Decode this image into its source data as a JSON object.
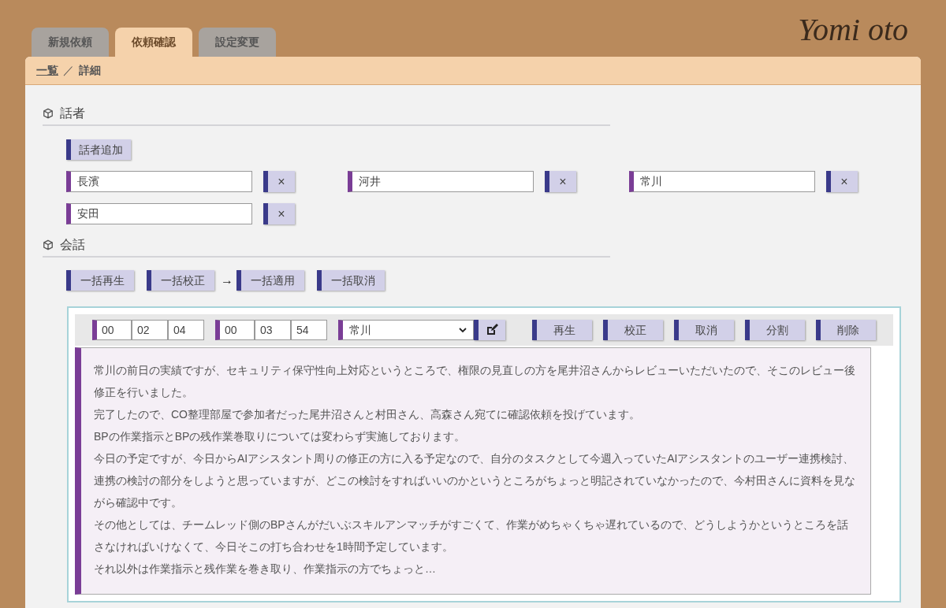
{
  "logo": "Yomi oto",
  "tabs": [
    {
      "label": "新規依頼",
      "selected": false
    },
    {
      "label": "依頼確認",
      "selected": true
    },
    {
      "label": "設定変更",
      "selected": false
    }
  ],
  "breadcrumb": {
    "link": "一覧",
    "separator": "／",
    "current": "詳細"
  },
  "speakers_section": {
    "title": "話者",
    "add_button": "話者追加",
    "remove_label": "×",
    "speakers": [
      "長濱",
      "河井",
      "常川",
      "安田"
    ]
  },
  "conversation_section": {
    "title": "会話",
    "bulk_actions": [
      {
        "kind": "button",
        "label": "一括再生"
      },
      {
        "kind": "button",
        "label": "一括校正"
      },
      {
        "kind": "arrow",
        "label": "→"
      },
      {
        "kind": "button",
        "label": "一括適用"
      },
      {
        "kind": "button",
        "label": "一括取消"
      }
    ],
    "segment": {
      "start": [
        "00",
        "02",
        "04"
      ],
      "end": [
        "00",
        "03",
        "54"
      ],
      "speaker": "常川",
      "actions": [
        "再生",
        "校正",
        "取消",
        "分割",
        "削除"
      ],
      "lines": [
        "常川の前日の実績ですが、セキュリティ保守性向上対応というところで、権限の見直しの方を尾井沼さんからレビューいただいたので、そこのレビュー後修正を行いました。",
        "完了したので、CO整理部屋で参加者だった尾井沼さんと村田さん、高森さん宛てに確認依頼を投げています。",
        "BPの作業指示とBPの残作業巻取りについては変わらず実施しております。",
        "今日の予定ですが、今日からAIアシスタント周りの修正の方に入る予定なので、自分のタスクとして今週入っていたAIアシスタントのユーザー連携検討、連携の検討の部分をしようと思っていますが、どこの検討をすればいいのかというところがちょっと明記されていなかったので、今村田さんに資料を見ながら確認中です。",
        "その他としては、チームレッド側のBPさんがだいぶスキルアンマッチがすごくて、作業がめちゃくちゃ遅れているので、どうしようかというところを話さなければいけなくて、今日そこの打ち合わせを1時間予定しています。",
        "それ以外は作業指示と残作業を巻き取り、作業指示の方でちょっと…"
      ]
    }
  }
}
